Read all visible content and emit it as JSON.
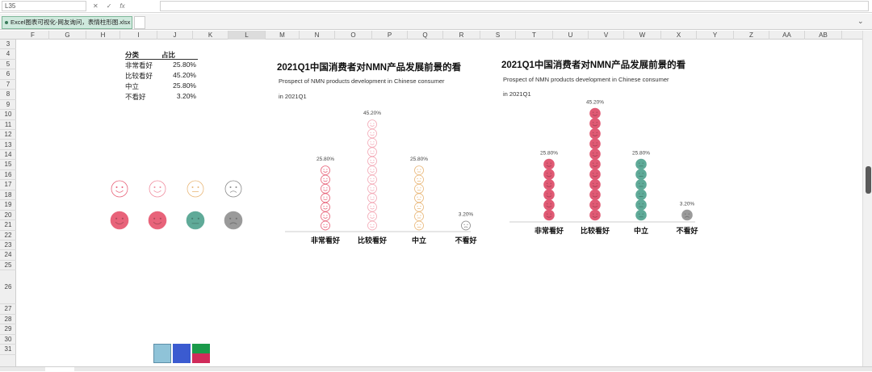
{
  "formula_bar": {
    "cell_ref": "L35",
    "cancel": "✕",
    "confirm": "✓",
    "fx": "fx"
  },
  "file_tab": {
    "label": "Excel图表可视化-网友询问，表情柱形图.xlsx"
  },
  "columns": [
    "F",
    "G",
    "H",
    "I",
    "J",
    "K",
    "L",
    "M",
    "N",
    "O",
    "P",
    "Q",
    "R",
    "S",
    "T",
    "U",
    "V",
    "W",
    "X",
    "Y",
    "Z",
    "AA",
    "AB"
  ],
  "rows": [
    "3",
    "4",
    "5",
    "6",
    "7",
    "8",
    "9",
    "10",
    "11",
    "12",
    "13",
    "14",
    "15",
    "16",
    "17",
    "18",
    "19",
    "20",
    "21",
    "22",
    "23",
    "24",
    "25",
    "26",
    "27",
    "28",
    "29",
    "30",
    "31"
  ],
  "table": {
    "header_category": "分类",
    "header_ratio": "占比",
    "rows": [
      {
        "category": "非常看好",
        "ratio": "25.80%"
      },
      {
        "category": "比较看好",
        "ratio": "45.20%"
      },
      {
        "category": "中立",
        "ratio": "25.80%"
      },
      {
        "category": "不看好",
        "ratio": "3.20%"
      }
    ]
  },
  "icon_colors": {
    "very_positive": "#e8637a",
    "positive": "#f08ea0",
    "neutral": "#e9b87a",
    "negative": "#8a8a8a",
    "teal": "#5faa98",
    "gray": "#9a9a9a"
  },
  "chart_data": [
    {
      "type": "bar",
      "style": "outline-smiley",
      "title": "2021Q1中国消费者对NMN产品发展前景的看",
      "subtitle_line1": "Prospect of NMN products development in Chinese consumer",
      "subtitle_line2": "in 2021Q1",
      "categories": [
        "非常看好",
        "比较看好",
        "中立",
        "不看好"
      ],
      "values": [
        25.8,
        45.2,
        25.8,
        3.2
      ],
      "data_labels": [
        "25.80%",
        "45.20%",
        "25.80%",
        "3.20%"
      ],
      "colors": [
        "#e8637a",
        "#f3a9b6",
        "#e9b87a",
        "#8a8a8a"
      ],
      "ylim": [
        0,
        50
      ],
      "grid": false
    },
    {
      "type": "bar",
      "style": "filled-smiley",
      "title": "2021Q1中国消费者对NMN产品发展前景的看",
      "subtitle_line1": "Prospect of NMN products development in Chinese consumer",
      "subtitle_line2": "in 2021Q1",
      "categories": [
        "非常看好",
        "比较看好",
        "中立",
        "不看好"
      ],
      "values": [
        25.8,
        45.2,
        25.8,
        3.2
      ],
      "data_labels": [
        "25.80%",
        "45.20%",
        "25.80%",
        "3.20%"
      ],
      "colors": [
        "#e05a74",
        "#e05a74",
        "#5faa98",
        "#9a9a9a"
      ],
      "ylim": [
        0,
        50
      ],
      "grid": false
    }
  ]
}
